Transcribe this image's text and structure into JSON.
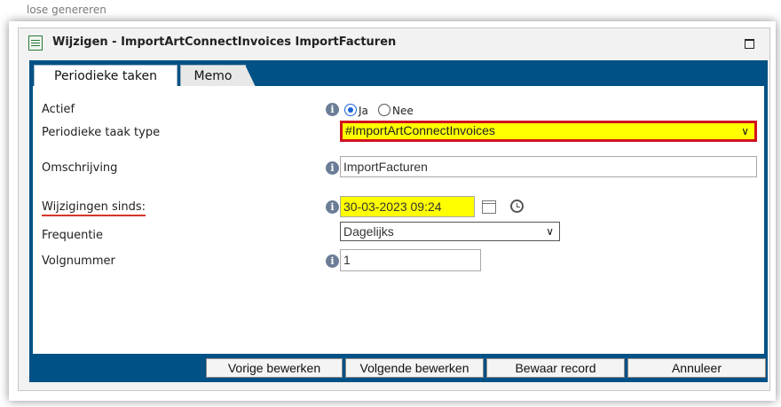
{
  "background_text": "lose genereren",
  "window": {
    "title": "Wijzigen - ImportArtConnectInvoices ImportFacturen"
  },
  "tabs": [
    {
      "label": "Periodieke taken",
      "active": true
    },
    {
      "label": "Memo",
      "active": false
    }
  ],
  "form": {
    "actief": {
      "label": "Actief",
      "options": [
        "Ja",
        "Nee"
      ],
      "selected": "Ja"
    },
    "type": {
      "label": "Periodieke taak type",
      "value": "#ImportArtConnectInvoices"
    },
    "omschrijving": {
      "label": "Omschrijving",
      "value": "ImportFacturen"
    },
    "wijzigingen": {
      "label": "Wijzigingen sinds:",
      "value": "30-03-2023 09:24"
    },
    "frequentie": {
      "label": "Frequentie",
      "value": "Dagelijks"
    },
    "volgnummer": {
      "label": "Volgnummer",
      "value": "1"
    },
    "info_glyph": "i"
  },
  "footer": {
    "prev": "Vorige bewerken",
    "next": "Volgende bewerken",
    "save": "Bewaar record",
    "cancel": "Annuleer"
  },
  "colors": {
    "accent": "#005185",
    "highlight": "#ffff00",
    "error_border": "#d0131e"
  }
}
